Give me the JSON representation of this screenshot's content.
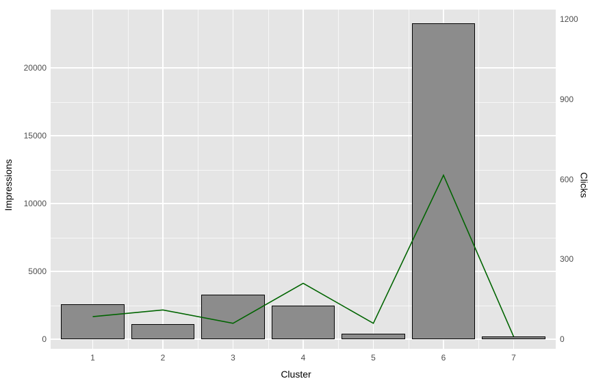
{
  "chart_data": {
    "type": "bar+line",
    "categories": [
      1,
      2,
      3,
      4,
      5,
      6,
      7
    ],
    "series": [
      {
        "name": "Impressions",
        "type": "bar",
        "values": [
          2600,
          1100,
          3300,
          2500,
          400,
          23300,
          200
        ]
      },
      {
        "name": "Clicks",
        "type": "line",
        "values": [
          85,
          110,
          60,
          210,
          60,
          615,
          10
        ]
      }
    ],
    "xlabel": "Cluster",
    "ylabel_left": "Impressions",
    "ylabel_right": "Clicks",
    "ylim_left": [
      -700,
      24300
    ],
    "ylim_right": [
      0,
      1200
    ],
    "yticks_left": [
      0,
      5000,
      10000,
      15000,
      20000
    ],
    "yticks_right": [
      0,
      300,
      600,
      900,
      1200
    ],
    "line_color": "#006400",
    "bar_fill": "#8C8C8C"
  }
}
